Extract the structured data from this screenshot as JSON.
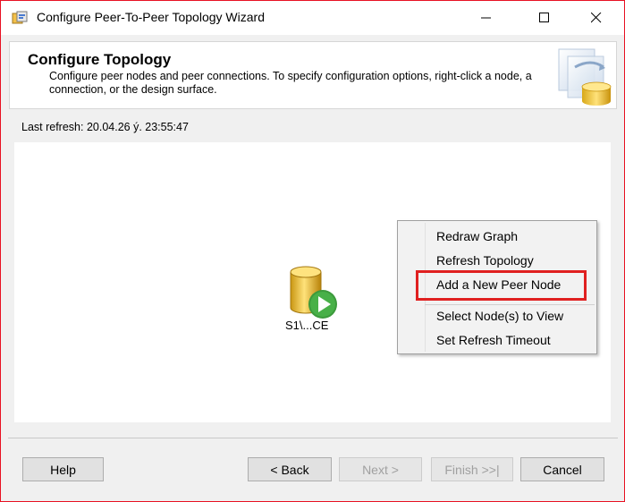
{
  "window": {
    "title": "Configure Peer-To-Peer Topology Wizard"
  },
  "header": {
    "title": "Configure Topology",
    "description": "Configure peer nodes and peer connections. To specify configuration options, right-click a node, a connection, or the design surface."
  },
  "status": {
    "last_refresh": "Last refresh: 20.04.26 ý. 23:55:47"
  },
  "node": {
    "label": "S1\\...CE"
  },
  "context_menu": {
    "items": [
      {
        "label": "Redraw Graph"
      },
      {
        "label": "Refresh Topology"
      },
      {
        "label": "Add a New Peer Node"
      },
      {
        "label": "Select Node(s) to View"
      },
      {
        "label": "Set Refresh Timeout"
      }
    ]
  },
  "buttons": {
    "help": "Help",
    "back": "< Back",
    "next": "Next >",
    "finish": "Finish >>|",
    "cancel": "Cancel"
  },
  "colors": {
    "highlight": "#e02020",
    "window_border": "#e81123"
  }
}
